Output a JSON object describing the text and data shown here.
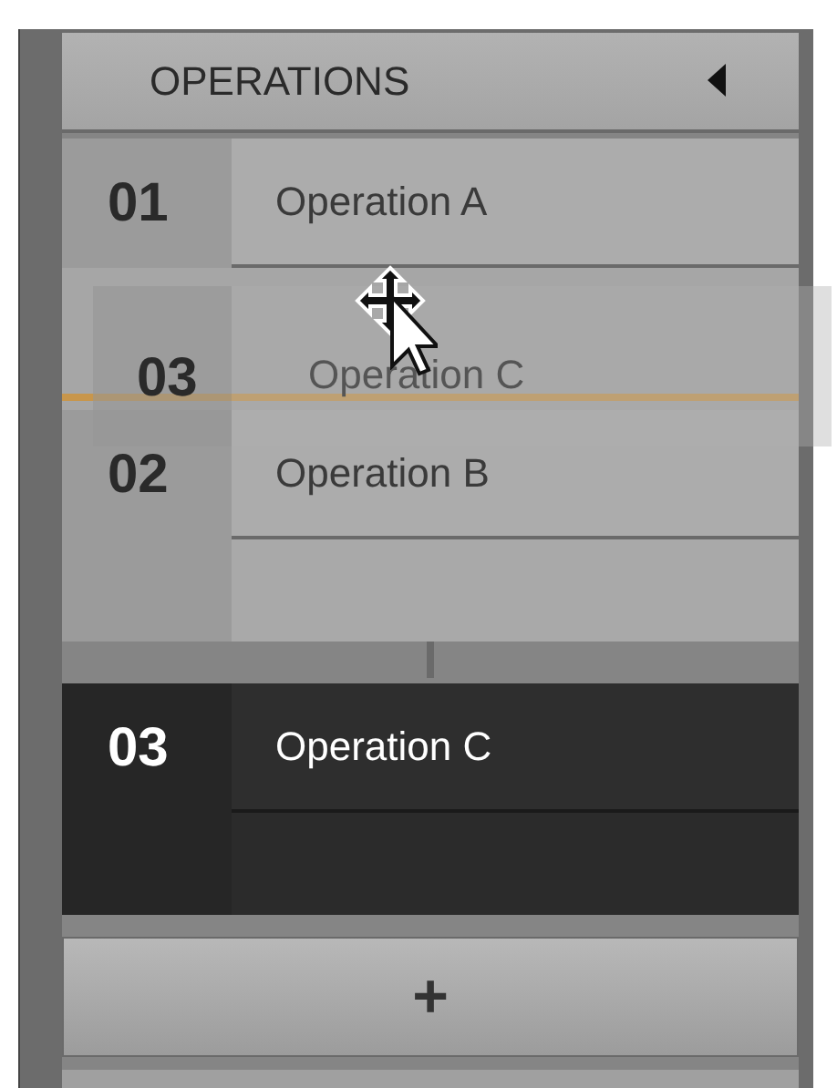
{
  "header": {
    "title": "OPERATIONS",
    "collapsed": false
  },
  "groups": [
    {
      "selected": false,
      "items": [
        {
          "kind": "operation",
          "number": "01",
          "name": "Operation A"
        },
        {
          "kind": "drop-line"
        },
        {
          "kind": "operation",
          "number": "02",
          "name": "Operation B"
        }
      ]
    },
    {
      "selected": true,
      "items": [
        {
          "kind": "operation",
          "number": "03",
          "name": "Operation C"
        }
      ]
    }
  ],
  "drag": {
    "number": "03",
    "name": "Operation C"
  },
  "add_button": {
    "label": "+"
  }
}
